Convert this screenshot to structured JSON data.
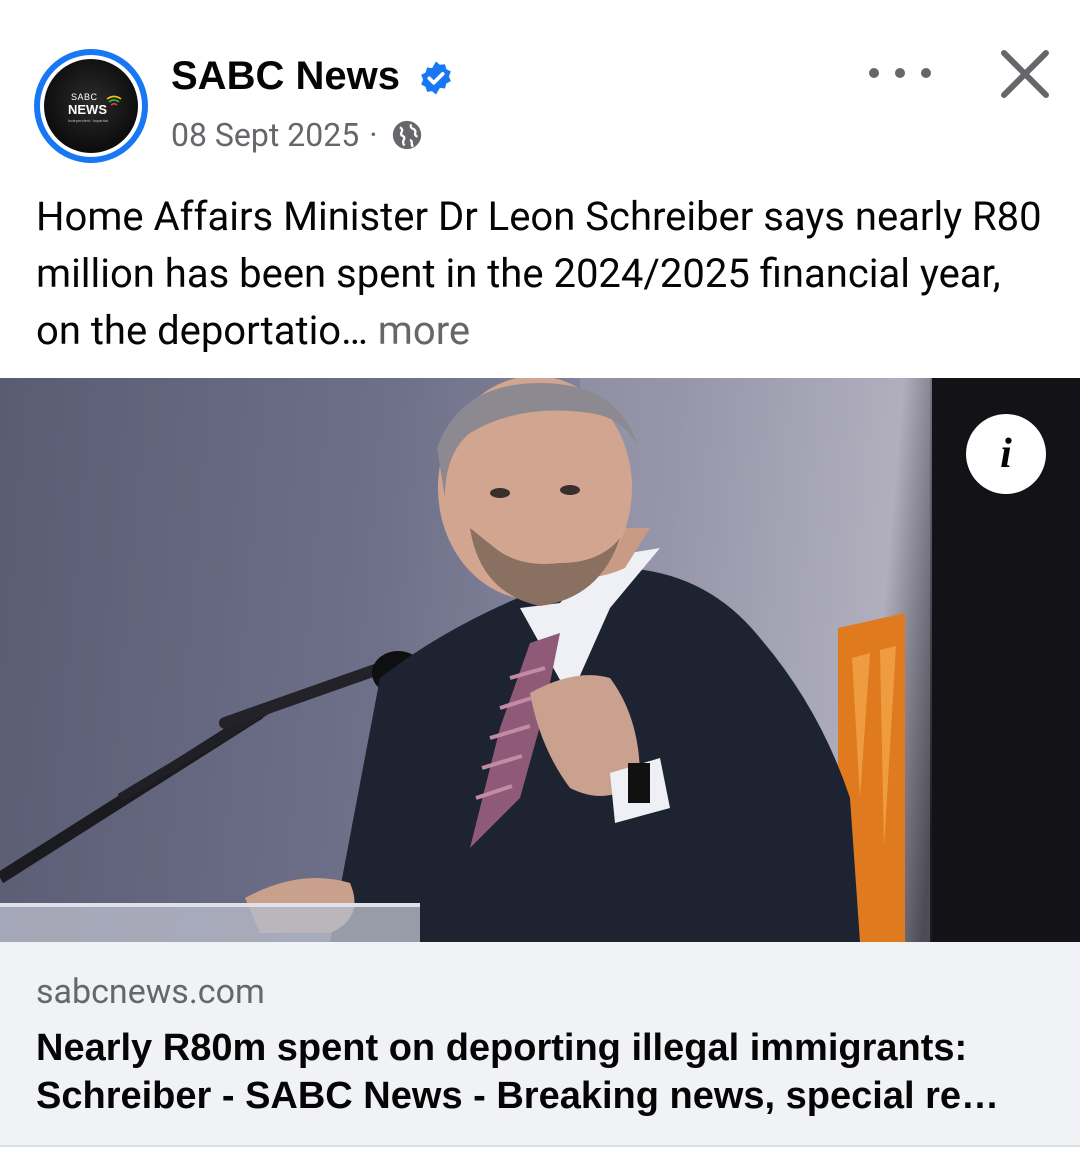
{
  "post": {
    "page_name": "SABC News",
    "date": "08 Sept 2025",
    "separator": "·",
    "text": "Home Affairs Minister Dr Leon Schreiber says nearly R80 million has been spent in the 2024/2025 financial year, on the deportatio…",
    "more_label": " more",
    "avatar": {
      "logo_top": "SABC",
      "logo_main": "NEWS",
      "logo_tagline": "Independent. Impartial.",
      "ring_color": "#1877f2"
    }
  },
  "icons": {
    "verified": "verified-badge-icon",
    "audience": "globe-icon",
    "more": "more-options-icon",
    "close": "close-icon",
    "info": "info-icon"
  },
  "image": {
    "info_label": "i"
  },
  "link_preview": {
    "domain": "sabcnews.com",
    "title": "Nearly R80m spent on deporting illegal immigrants: Schreiber - SABC News - Breaking news, special re…"
  },
  "colors": {
    "accent": "#1877f2",
    "secondary_text": "#65676b",
    "card_background": "#f0f2f5"
  }
}
